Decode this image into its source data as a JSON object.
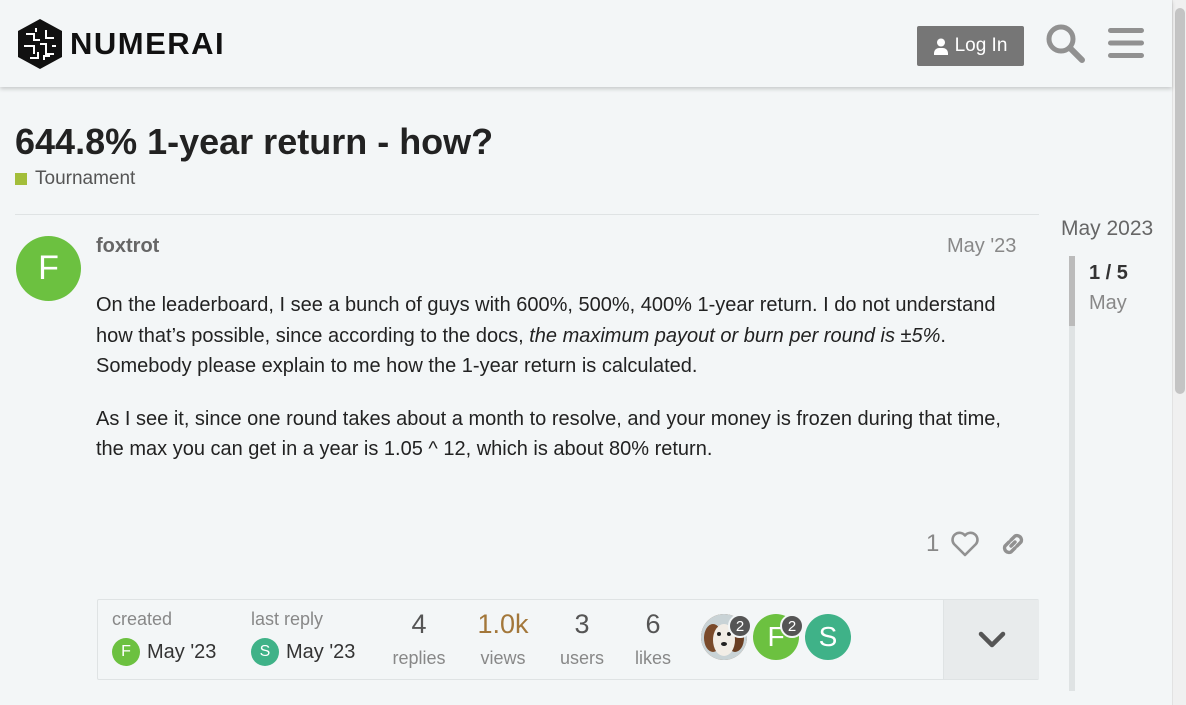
{
  "header": {
    "logo_text": "NUMERAI",
    "login_label": "Log In",
    "search_icon": "search-icon",
    "menu_icon": "hamburger-menu-icon"
  },
  "topic": {
    "title": "644.8% 1-year return - how?",
    "category": "Tournament",
    "category_color": "#a3be3a"
  },
  "post": {
    "avatar_letter": "F",
    "avatar_color": "#6cc140",
    "username": "foxtrot",
    "date": "May '23",
    "p1_a": "On the leaderboard, I see a bunch of guys with 600%, 500%, 400% 1-year return. I do not understand how that’s possible, since according to the docs, ",
    "p1_em": "the maximum payout or burn per round is ±5%",
    "p1_b": ". Somebody please explain to me how the 1-year return is calculated.",
    "p2": "As I see it, since one round takes about a month to resolve, and your money is frozen during that time, the max you can get in a year is 1.05 ^ 12, which is about 80% return.",
    "likes": "1"
  },
  "summary": {
    "created_label": "created",
    "created_avatar": "F",
    "created_date": "May '23",
    "last_reply_label": "last reply",
    "last_reply_avatar": "S",
    "last_reply_date": "May '23",
    "replies": "4",
    "replies_label": "replies",
    "views": "1.0k",
    "views_label": "views",
    "users": "3",
    "users_label": "users",
    "likes": "6",
    "likes_label": "likes",
    "participants": [
      {
        "letter": "",
        "count": "2",
        "color": "#8a5a3a"
      },
      {
        "letter": "F",
        "count": "2",
        "color": "#6cc140"
      },
      {
        "letter": "S",
        "count": "",
        "color": "#3fb288"
      }
    ]
  },
  "timeline": {
    "date": "May 2023",
    "position": "1 / 5",
    "month": "May"
  }
}
